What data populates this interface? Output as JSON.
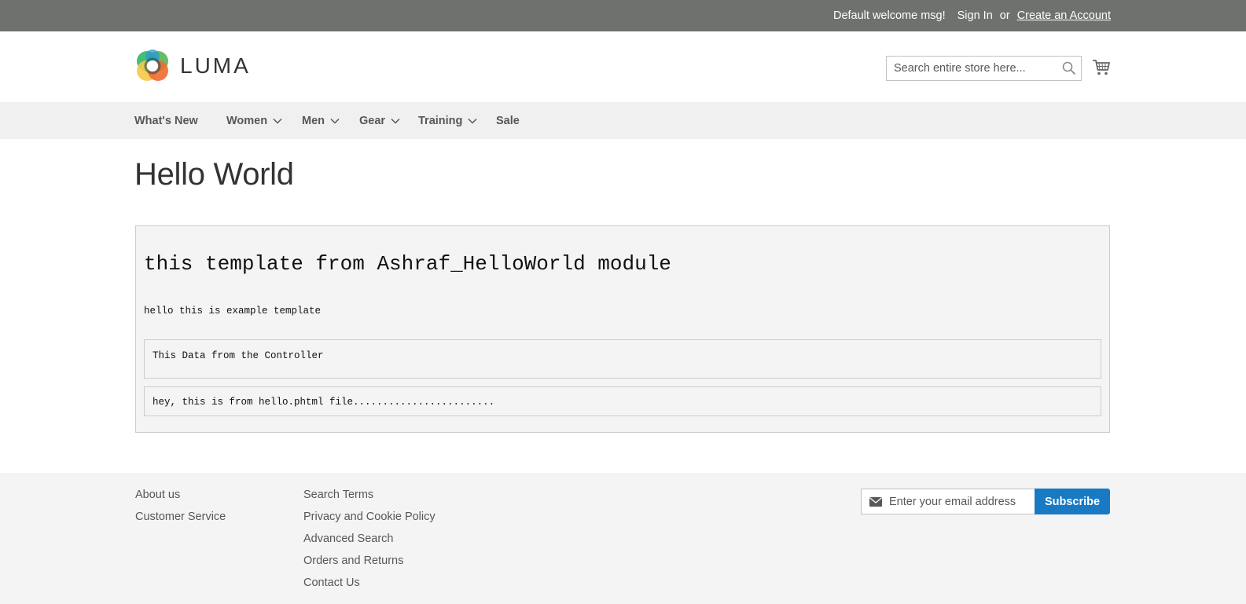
{
  "panel": {
    "welcome": "Default welcome msg!",
    "sign_in": "Sign In",
    "or": "or",
    "create_account": "Create an Account",
    "bg_color": "#6e716e"
  },
  "header": {
    "logo_text": "LUMA",
    "search_placeholder": "Search entire store here...",
    "search_icon": "search-icon",
    "cart_icon": "cart-icon"
  },
  "nav": {
    "items": [
      {
        "label": "What's New",
        "has_dropdown": false
      },
      {
        "label": "Women",
        "has_dropdown": true
      },
      {
        "label": "Men",
        "has_dropdown": true
      },
      {
        "label": "Gear",
        "has_dropdown": true
      },
      {
        "label": "Training",
        "has_dropdown": true
      },
      {
        "label": "Sale",
        "has_dropdown": false
      }
    ]
  },
  "main": {
    "page_title": "Hello World",
    "template_heading": "this template from Ashraf_HelloWorld module",
    "template_text": "hello this is example template",
    "controller_data": "This Data from the Controller",
    "phtml_text": "hey, this is from hello.phtml file........................"
  },
  "footer": {
    "col1": [
      "About us",
      "Customer Service"
    ],
    "col2": [
      "Search Terms",
      "Privacy and Cookie Policy",
      "Advanced Search",
      "Orders and Returns",
      "Contact Us"
    ],
    "newsletter_placeholder": "Enter your email address",
    "subscribe_label": "Subscribe",
    "accent_color": "#1979c3"
  }
}
